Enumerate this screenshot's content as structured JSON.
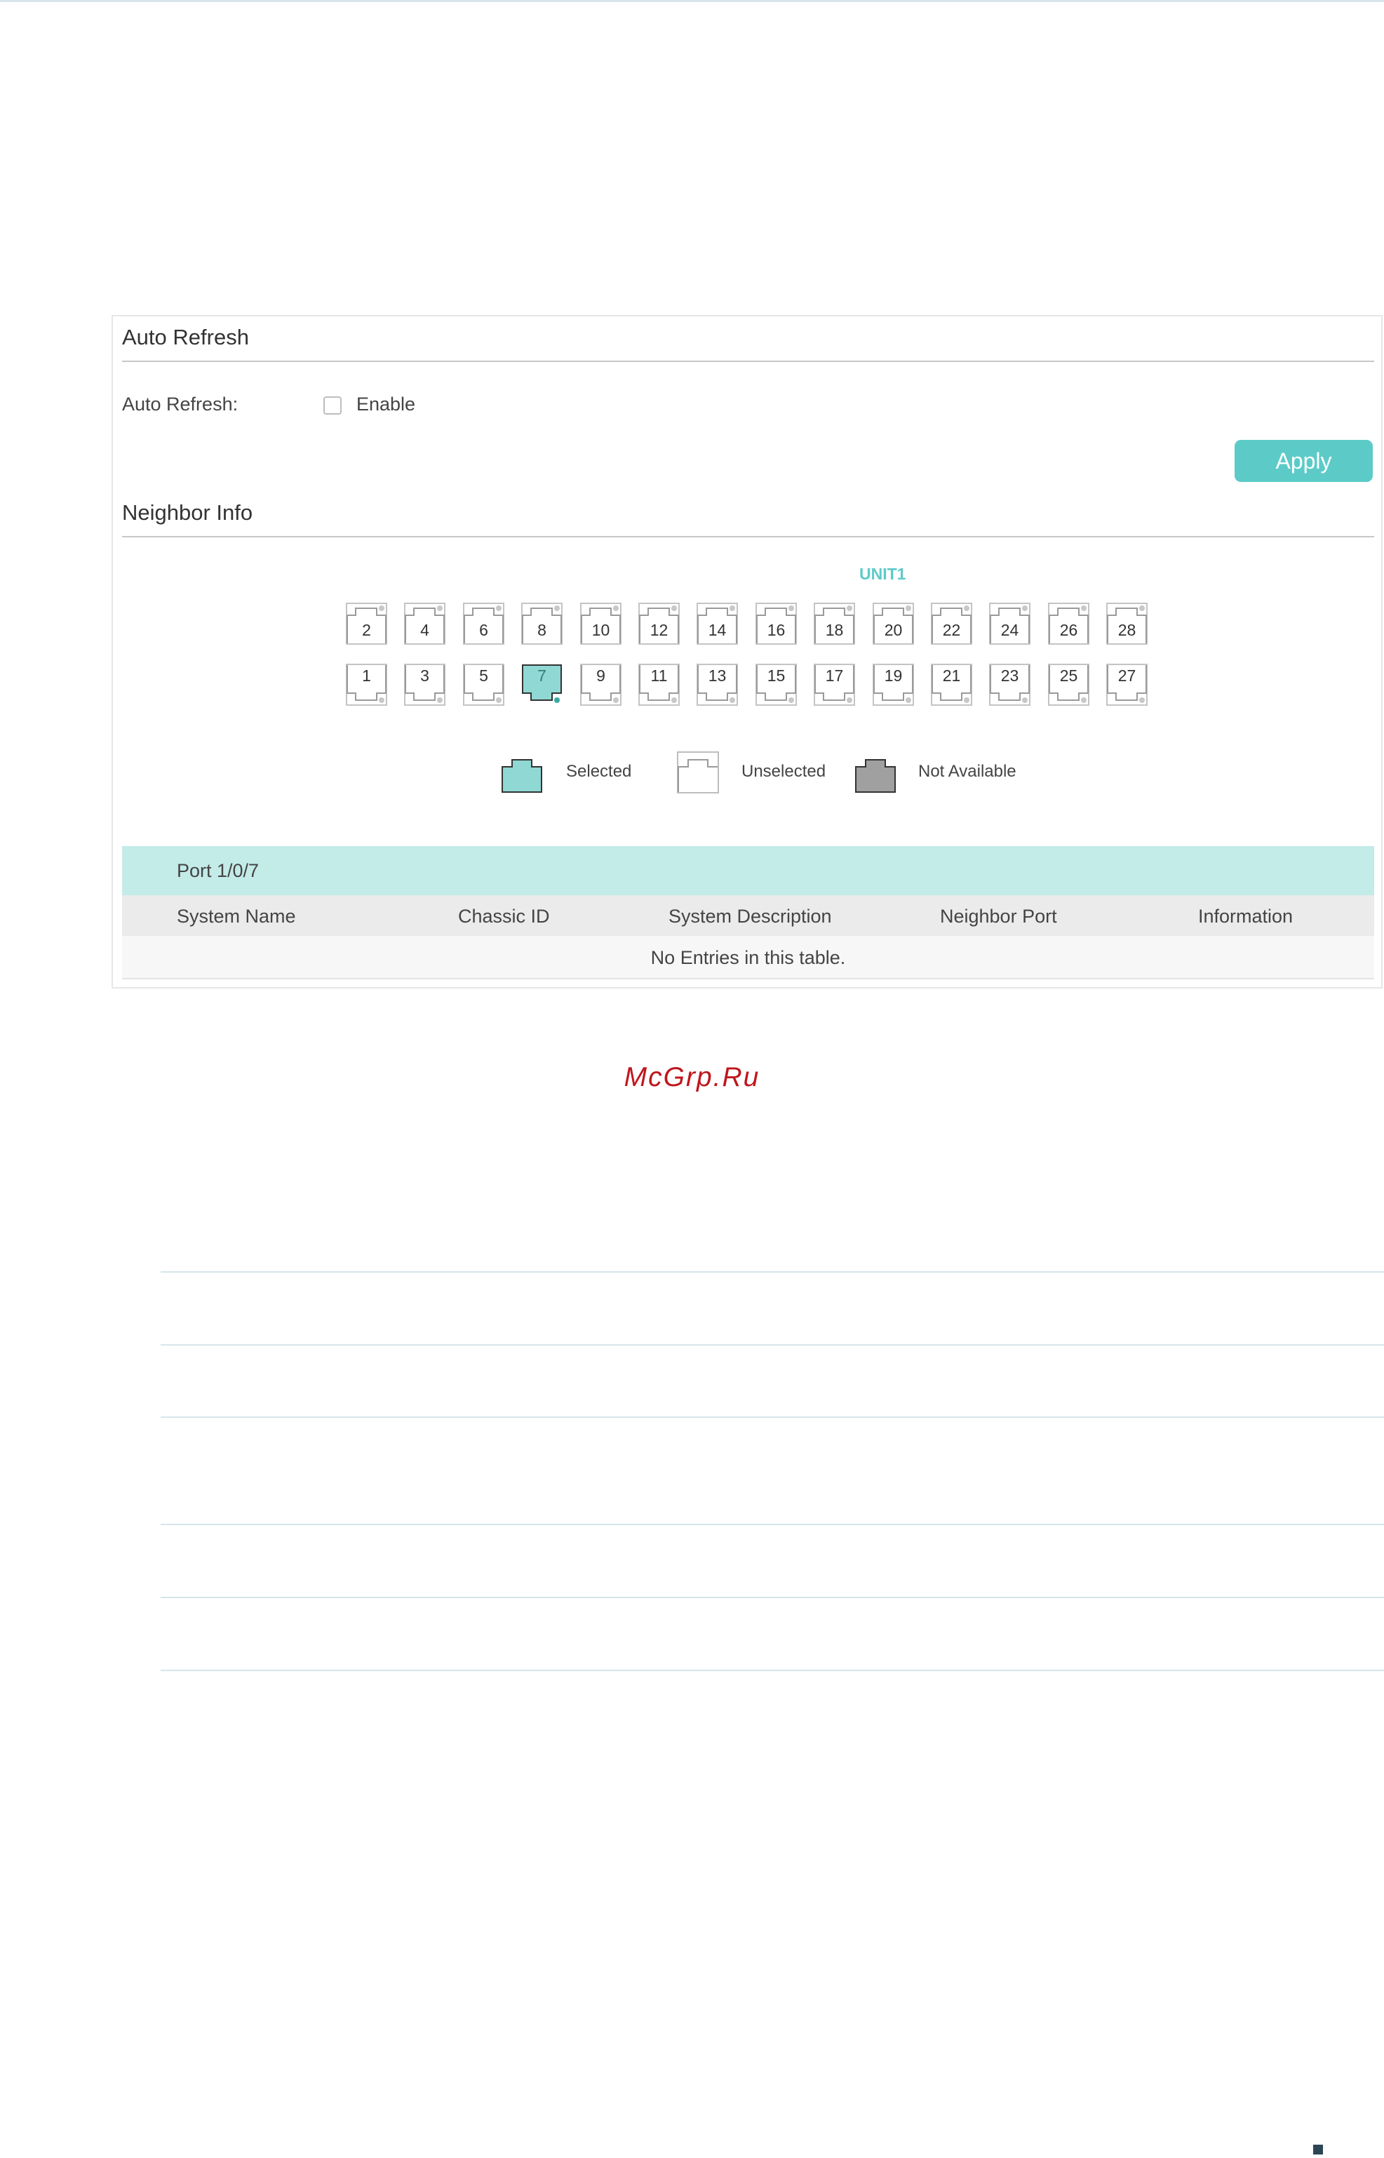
{
  "auto_refresh": {
    "section_title": "Auto Refresh",
    "field_label": "Auto Refresh:",
    "checkbox_label": "Enable",
    "checked": false,
    "apply_label": "Apply"
  },
  "neighbor_info": {
    "section_title": "Neighbor Info",
    "unit_label": "UNIT1",
    "ports_top": [
      "2",
      "4",
      "6",
      "8",
      "10",
      "12",
      "14",
      "16",
      "18",
      "20",
      "22",
      "24",
      "26",
      "28"
    ],
    "ports_bottom": [
      "1",
      "3",
      "5",
      "7",
      "9",
      "11",
      "13",
      "15",
      "17",
      "19",
      "21",
      "23",
      "25",
      "27"
    ],
    "selected_port": "7",
    "legend": {
      "selected": "Selected",
      "unselected": "Unselected",
      "not_available": "Not Available"
    }
  },
  "table": {
    "port_title": "Port 1/0/7",
    "columns": [
      "System Name",
      "Chassic ID",
      "System Description",
      "Neighbor Port",
      "Information"
    ],
    "empty_text": "No Entries in this table."
  },
  "watermark": "McGrp.Ru",
  "colors": {
    "accent": "#5ccbc8",
    "header_bg": "#c3ebe8",
    "selected_port_fill": "#8fd8d4",
    "not_available_fill": "#a0a0a0",
    "watermark": "#c0161d"
  }
}
